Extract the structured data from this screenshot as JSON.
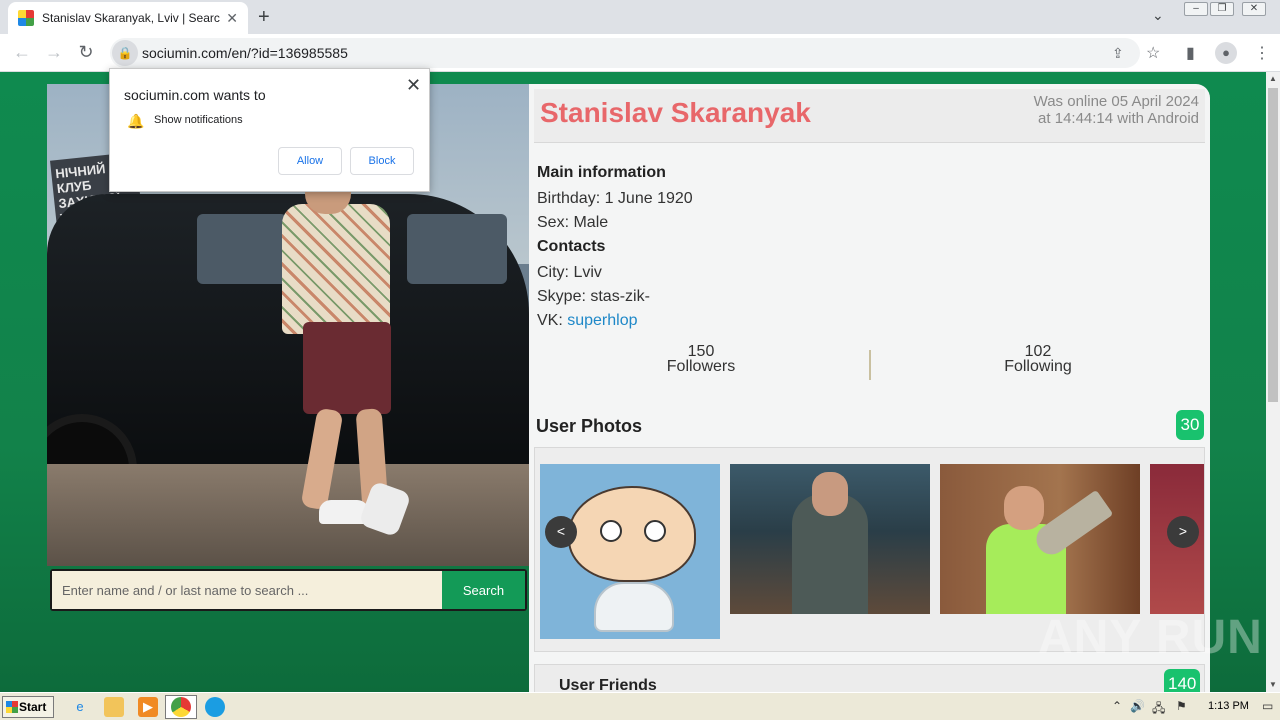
{
  "browser": {
    "tab_title": "Stanislav Skaranyak, Lviv | Search In",
    "tab_close": "✕",
    "new_tab": "+",
    "url": "sociumin.com/en/?id=136985585"
  },
  "notification_popup": {
    "title": "sociumin.com wants to",
    "permission": "Show notifications",
    "allow_label": "Allow",
    "block_label": "Block",
    "close": "✕"
  },
  "search": {
    "placeholder": "Enter name and / or last name to search ...",
    "button_label": "Search"
  },
  "profile": {
    "name": "Stanislav Skaranyak",
    "online_line1": "Was online 05 April 2024",
    "online_line2": "at 14:44:14 with Android",
    "main_info_heading": "Main information",
    "birthday": "Birthday: 1 June 1920",
    "sex": "Sex: Male",
    "contacts_heading": "Contacts",
    "city": "City: Lviv",
    "skype": "Skype: stas-zik-",
    "vk_label": "VK: ",
    "vk_link": "superhlop",
    "followers_count": "150",
    "followers_label": "Followers",
    "following_count": "102",
    "following_label": "Following"
  },
  "photos": {
    "title": "User Photos",
    "count": "30",
    "prev": "<",
    "next": ">"
  },
  "friends": {
    "title": "User Friends",
    "count": "140"
  },
  "photo_sign_text": "НІЧНИЙ КЛУБ ЗАХІДНОЇ УКРАЇНИ",
  "watermark": "ANY RUN",
  "taskbar": {
    "start_label": "Start",
    "clock": "1:13 PM"
  },
  "colors": {
    "page_green": "#0f8a4f",
    "name_red": "#e8676a",
    "badge_green": "#19c26e",
    "link_blue": "#1e88c8"
  },
  "icons": [
    "lock-icon",
    "bell-icon",
    "share-icon",
    "star-icon",
    "sidebar-icon",
    "profile-icon",
    "menu-icon",
    "back-icon",
    "forward-icon",
    "reload-icon"
  ]
}
